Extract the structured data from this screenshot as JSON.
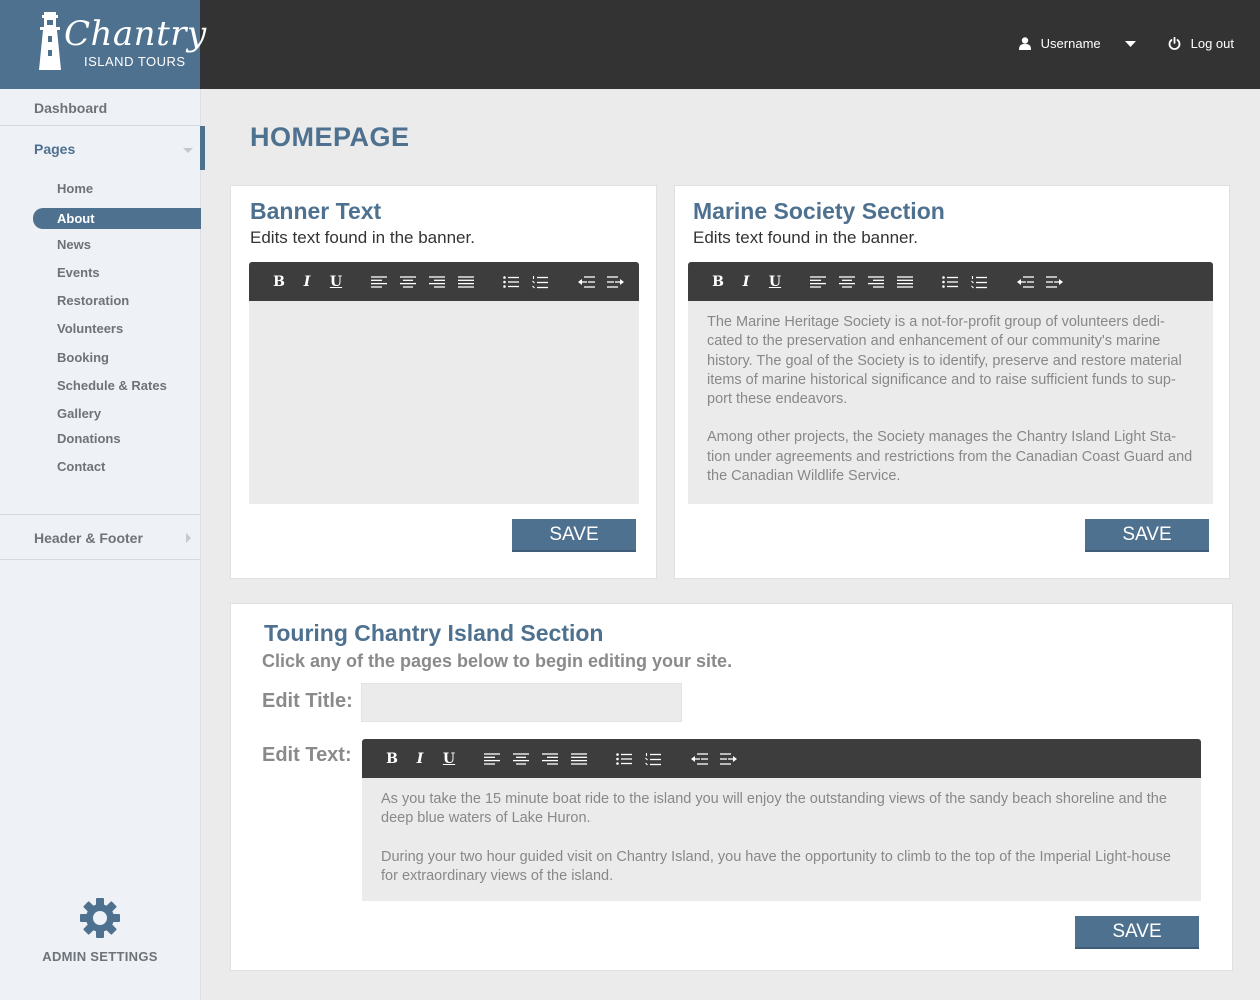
{
  "app": {
    "logo_script": "Chantry",
    "logo_sub": "ISLAND TOURS"
  },
  "header": {
    "username": "Username",
    "logout": "Log out"
  },
  "sidebar": {
    "dashboard": "Dashboard",
    "pages": "Pages",
    "sub_items": [
      "Home",
      "About",
      "News",
      "Events",
      "Restoration",
      "Volunteers",
      "Booking",
      "Schedule & Rates",
      "Gallery",
      "Donations",
      "Contact"
    ],
    "active_item": "About",
    "header_footer": "Header & Footer",
    "admin_settings": "ADMIN SETTINGS"
  },
  "main": {
    "page_title": "HOMEPAGE",
    "banner": {
      "title": "Banner Text",
      "subtitle": "Edits text found in the banner.",
      "save": "SAVE"
    },
    "marine": {
      "title": "Marine Society Section",
      "subtitle": "Edits text found in the banner.",
      "p1": "The Marine Heritage Society is a not-for-profit group of volunteers dedi-cated to the preservation and enhancement of our community's marine history. The goal of the Society is to identify, preserve and restore material items of marine historical significance and to raise sufficient funds to sup-port these endeavors.",
      "p2": "Among other projects, the Society manages the Chantry Island Light Sta-tion under agreements and restrictions from the Canadian Coast Guard and the Canadian Wildlife Service.",
      "save": "SAVE"
    },
    "touring": {
      "title": "Touring Chantry Island Section",
      "subtitle": "Click any of the pages below to begin editing your site.",
      "edit_title_label": "Edit Title:",
      "edit_text_label": "Edit Text:",
      "title_value": "",
      "p1": "As you take the 15 minute boat ride to the island you will enjoy the outstanding views of the sandy beach shoreline and the deep blue waters of Lake Huron.",
      "p2": "During your two hour guided visit on Chantry Island, you have the opportunity to climb to the top of the Imperial Light-house for extraordinary views of the island.",
      "save": "SAVE"
    }
  },
  "toolbar": {
    "bold": "B",
    "italic": "I",
    "underline": "U"
  },
  "colors": {
    "accent": "#4e7190",
    "topbar": "#333333",
    "toolbar": "#3d3d3d",
    "sidebar_bg": "#eef1f6",
    "editor_bg": "#ebebeb"
  }
}
